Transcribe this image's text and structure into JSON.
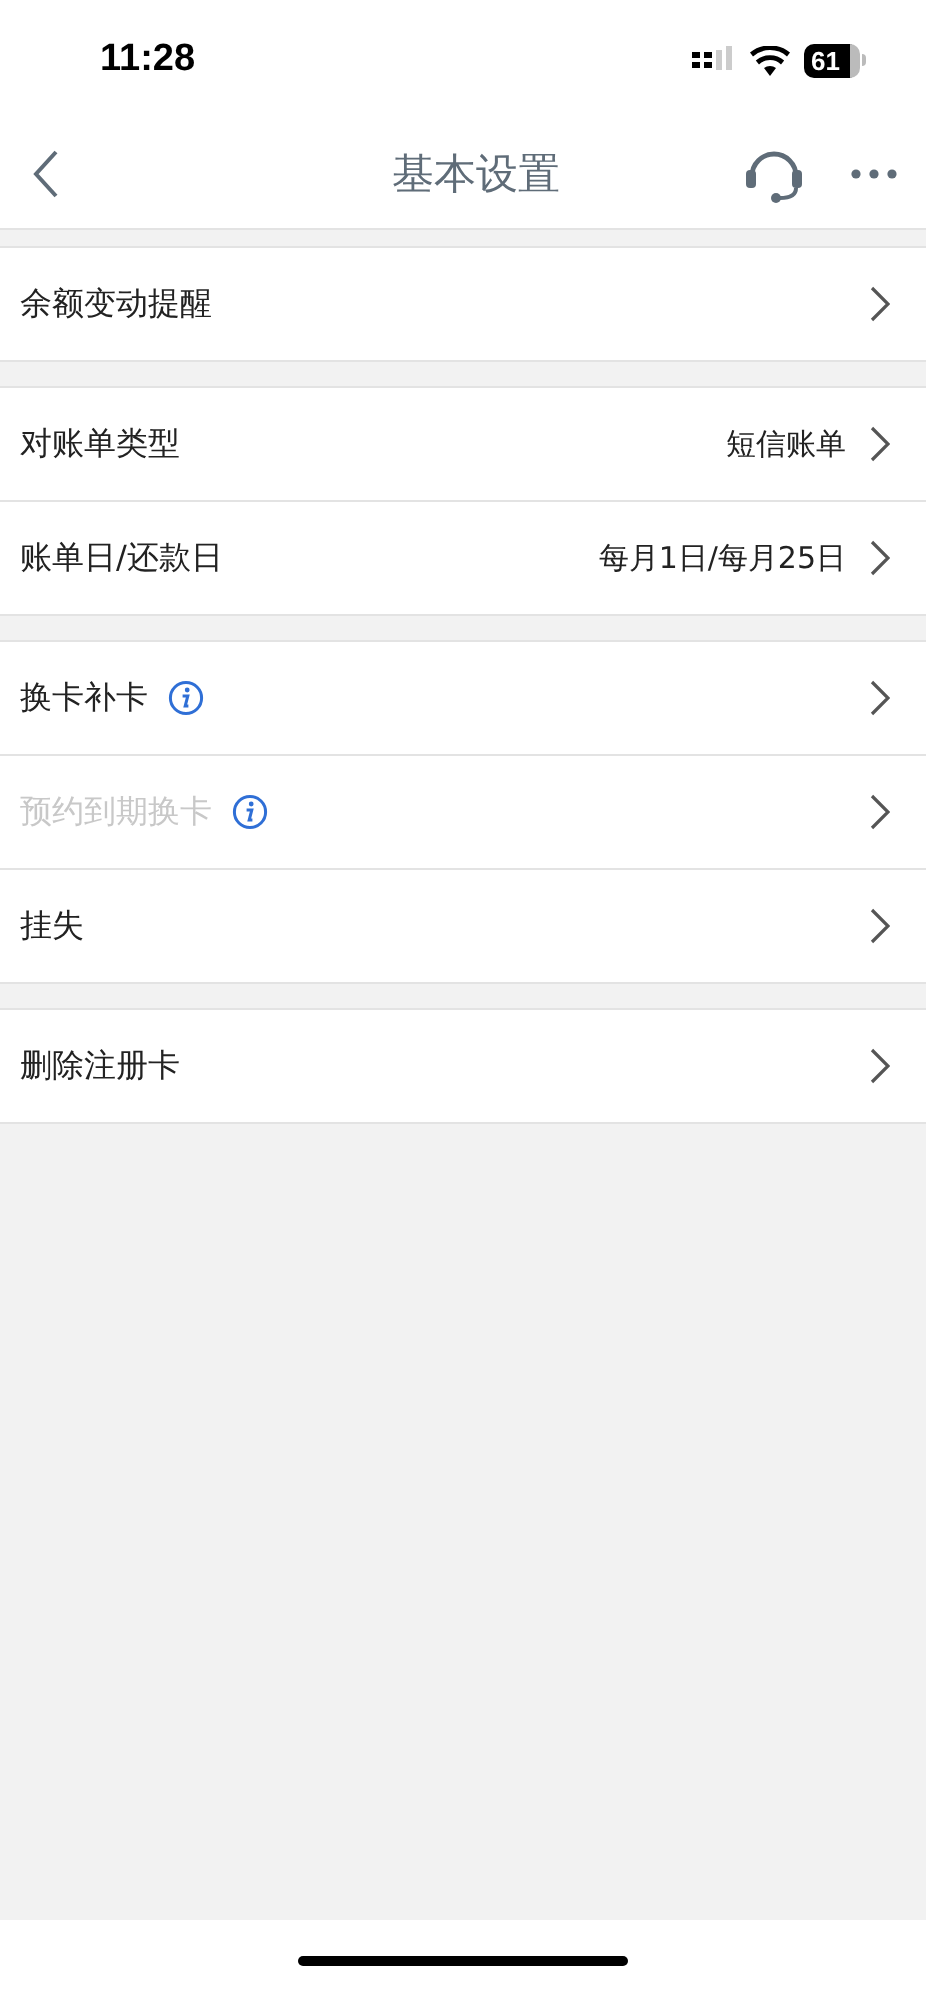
{
  "status_bar": {
    "time": "11:28",
    "battery": "61"
  },
  "nav": {
    "title": "基本设置"
  },
  "groups": [
    {
      "items": [
        {
          "label": "余额变动提醒",
          "info": false,
          "disabled": false
        }
      ]
    },
    {
      "items": [
        {
          "label": "对账单类型",
          "value": "短信账单",
          "info": false,
          "disabled": false
        },
        {
          "label": "账单日/还款日",
          "value": "每月1日/每月25日",
          "info": false,
          "disabled": false
        }
      ]
    },
    {
      "items": [
        {
          "label": "换卡补卡",
          "info": true,
          "disabled": false
        },
        {
          "label": "预约到期换卡",
          "info": true,
          "disabled": true
        },
        {
          "label": "挂失",
          "info": false,
          "disabled": false
        }
      ]
    },
    {
      "items": [
        {
          "label": "删除注册卡",
          "info": false,
          "disabled": false
        }
      ]
    }
  ]
}
